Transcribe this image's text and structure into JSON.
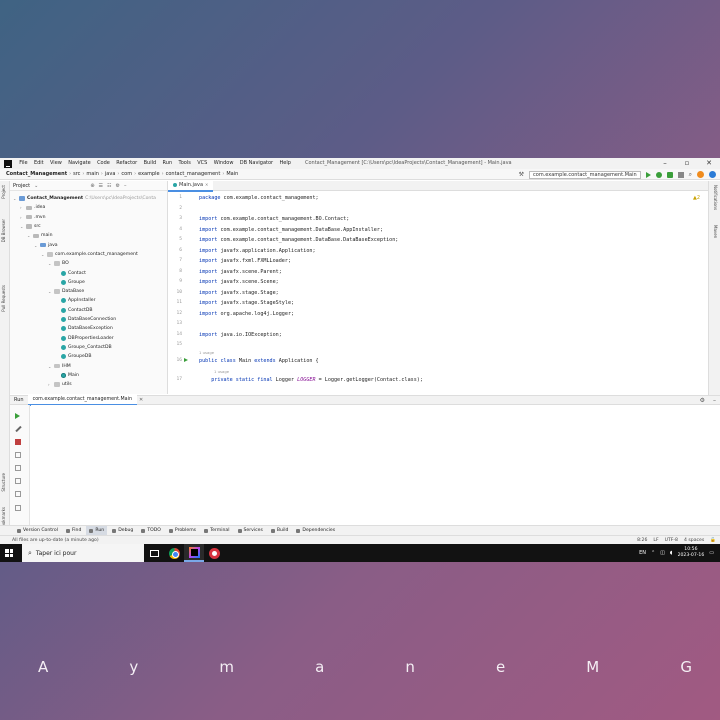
{
  "window": {
    "title": "Contact_Management [C:\\Users\\pc\\IdeaProjects\\Contact_Management] - Main.java",
    "menu": [
      "File",
      "Edit",
      "View",
      "Navigate",
      "Code",
      "Refactor",
      "Build",
      "Run",
      "Tools",
      "VCS",
      "Window",
      "DB Navigator",
      "Help"
    ]
  },
  "navbar": {
    "breadcrumbs": [
      "Contact_Management",
      "src",
      "main",
      "java",
      "com",
      "example",
      "contact_management",
      "Main"
    ],
    "run_config": "com.example.contact_management.Main"
  },
  "left_strip": [
    "Project",
    "DB Browser",
    "Pull Requests",
    "Structure",
    "Bookmarks"
  ],
  "project_panel": {
    "title": "Project",
    "tree": [
      {
        "label": "Contact_Management",
        "suffix": "C:\\Users\\pc\\IdeaProjects\\Conta"
      },
      {
        "label": ".idea"
      },
      {
        "label": ".mvn"
      },
      {
        "label": "src"
      },
      {
        "label": "main"
      },
      {
        "label": "java"
      },
      {
        "label": "com.example.contact_management"
      },
      {
        "label": "BO"
      },
      {
        "label": "Contact"
      },
      {
        "label": "Groupe"
      },
      {
        "label": "DataBase"
      },
      {
        "label": "AppInstaller"
      },
      {
        "label": "ContactDB"
      },
      {
        "label": "DataBaseConnection"
      },
      {
        "label": "DataBaseException"
      },
      {
        "label": "DBPropertiesLoader"
      },
      {
        "label": "Groupe_ContactDB"
      },
      {
        "label": "GroupeDB"
      },
      {
        "label": "IHM"
      },
      {
        "label": "Main"
      },
      {
        "label": "utils"
      }
    ]
  },
  "editor": {
    "tab": "Main.java",
    "warnings": "2",
    "lines": [
      {
        "n": "1",
        "kw": "package",
        "rest": " com.example.contact_management;"
      },
      {
        "n": "2",
        "kw": "",
        "rest": ""
      },
      {
        "n": "3",
        "kw": "import",
        "rest": " com.example.contact_management.BO.Contact;"
      },
      {
        "n": "4",
        "kw": "import",
        "rest": " com.example.contact_management.DataBase.AppInstaller;"
      },
      {
        "n": "5",
        "kw": "import",
        "rest": " com.example.contact_management.DataBase.DataBaseException;"
      },
      {
        "n": "6",
        "kw": "import",
        "rest": " javafx.application.Application;"
      },
      {
        "n": "7",
        "kw": "import",
        "rest": " javafx.fxml.FXMLLoader;"
      },
      {
        "n": "8",
        "kw": "import",
        "rest": " javafx.scene.Parent;"
      },
      {
        "n": "9",
        "kw": "import",
        "rest": " javafx.scene.Scene;"
      },
      {
        "n": "10",
        "kw": "import",
        "rest": " javafx.stage.Stage;"
      },
      {
        "n": "11",
        "kw": "import",
        "rest": " javafx.stage.StageStyle;"
      },
      {
        "n": "12",
        "kw": "import",
        "rest": " org.apache.log4j.Logger;"
      },
      {
        "n": "13",
        "kw": "",
        "rest": ""
      },
      {
        "n": "14",
        "kw": "import",
        "rest": " java.io.IOException;"
      },
      {
        "n": "15",
        "kw": "",
        "rest": ""
      },
      {
        "n": "16",
        "kw": "public class",
        "rest": " Main ",
        "kw2": "extends",
        "rest2": " Application {"
      },
      {
        "n": "17",
        "kw": "    private static final",
        "rest": " Logger ",
        "const": "LOGGER",
        "rest2": " = Logger.getLogger(Contact.class);"
      }
    ],
    "usage_hint_1": "1 usage",
    "usage_hint_2": "1 usage"
  },
  "right_strip": [
    "Notifications",
    "Maven"
  ],
  "run_panel": {
    "label": "Run",
    "tab": "com.example.contact_management.Main"
  },
  "bottom_tabs": [
    "Version Control",
    "Find",
    "Run",
    "Debug",
    "TODO",
    "Problems",
    "Terminal",
    "Services",
    "Build",
    "Dependencies"
  ],
  "status": {
    "message": "All files are up-to-date (a minute ago)",
    "position": "8:26",
    "line_sep": "LF",
    "encoding": "UTF-8",
    "indent": "4 spaces"
  },
  "taskbar": {
    "search_placeholder": "Taper ici pour",
    "lang": "EN",
    "time": "10:56",
    "date": "2023-07-16"
  },
  "signature_letters": [
    "A",
    "y",
    "m",
    "a",
    "n",
    "e",
    "M",
    "G"
  ]
}
